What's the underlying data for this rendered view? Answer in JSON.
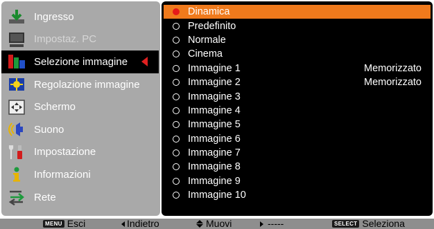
{
  "sidebar": {
    "items": [
      {
        "label": "Ingresso",
        "icon": "input-icon",
        "disabled": false
      },
      {
        "label": "Impostaz. PC",
        "icon": "computer-icon",
        "disabled": true
      },
      {
        "label": "Selezione immagine",
        "icon": "image-select-icon",
        "disabled": false,
        "selected": true
      },
      {
        "label": "Regolazione immagine",
        "icon": "image-adjust-icon",
        "disabled": false
      },
      {
        "label": "Schermo",
        "icon": "screen-icon",
        "disabled": false
      },
      {
        "label": "Suono",
        "icon": "speaker-icon",
        "disabled": false
      },
      {
        "label": "Impostazione",
        "icon": "settings-icon",
        "disabled": false
      },
      {
        "label": "Informazioni",
        "icon": "info-icon",
        "disabled": false
      },
      {
        "label": "Rete",
        "icon": "network-icon",
        "disabled": false
      }
    ]
  },
  "options": [
    {
      "label": "Dinamica",
      "status": "",
      "selected": true
    },
    {
      "label": "Predefinito",
      "status": ""
    },
    {
      "label": "Normale",
      "status": ""
    },
    {
      "label": "Cinema",
      "status": ""
    },
    {
      "label": "Immagine 1",
      "status": "Memorizzato"
    },
    {
      "label": "Immagine 2",
      "status": "Memorizzato"
    },
    {
      "label": "Immagine 3",
      "status": ""
    },
    {
      "label": "Immagine 4",
      "status": ""
    },
    {
      "label": "Immagine 5",
      "status": ""
    },
    {
      "label": "Immagine 6",
      "status": ""
    },
    {
      "label": "Immagine 7",
      "status": ""
    },
    {
      "label": "Immagine 8",
      "status": ""
    },
    {
      "label": "Immagine 9",
      "status": ""
    },
    {
      "label": "Immagine 10",
      "status": ""
    }
  ],
  "footer": {
    "menu_key": "MENU",
    "exit_label": "Esci",
    "back_label": "Indietro",
    "move_label": "Muovi",
    "next_label": "-----",
    "select_key": "SELECT",
    "select_label": "Seleziona"
  },
  "colors": {
    "highlight": "#f07a1c",
    "arrow": "#e02020",
    "sidebar_bg": "#a9a9a9",
    "panel_bg": "#000000"
  }
}
